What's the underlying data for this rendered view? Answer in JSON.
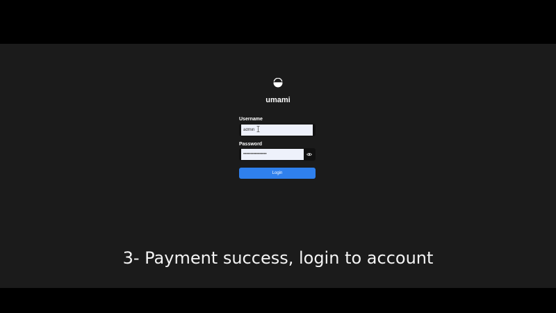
{
  "app": {
    "name": "umami"
  },
  "login_form": {
    "username_label": "Username",
    "username_value": "admin",
    "password_label": "Password",
    "password_value": "••••••••••••••••",
    "login_label": "Login"
  },
  "caption": {
    "text": "3- Payment success, login to account"
  },
  "colors": {
    "background": "#1b1b1b",
    "accent": "#2f80ed",
    "input_bg": "#eef1fb"
  },
  "icons": {
    "logo": "umami-logo-icon",
    "toggle_password": "eye-icon",
    "cursor": "text-cursor-icon"
  }
}
